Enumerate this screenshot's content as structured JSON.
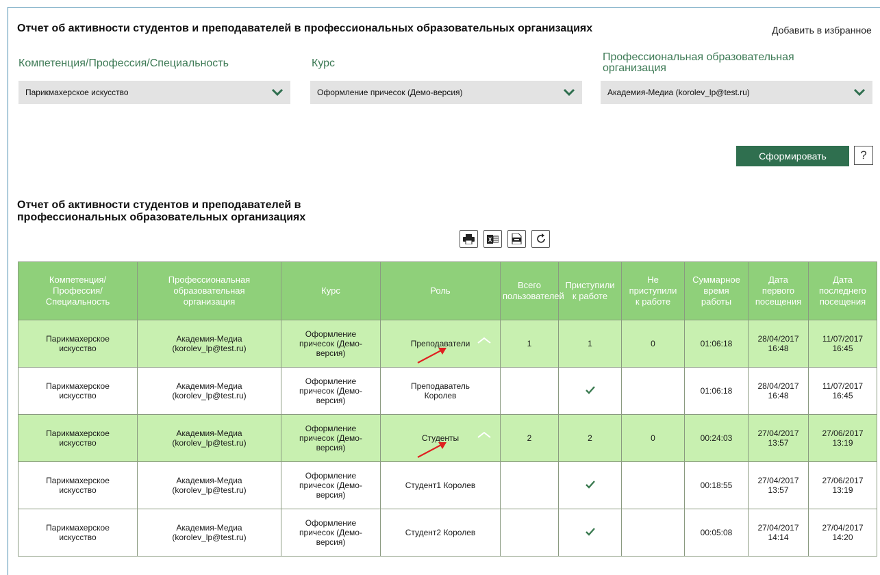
{
  "header": {
    "title": "Отчет об активности студентов и преподавателей в профессиональных образовательных организациях",
    "favorite": "Добавить в избранное"
  },
  "filters": {
    "competence": {
      "label": "Компетенция/Профессия/Специальность",
      "value": "Парикмахерское искусство"
    },
    "course": {
      "label": "Курс",
      "value": "Оформление причесок (Демо-версия)"
    },
    "organization": {
      "label_line1": "Профессиональная образовательная",
      "label_line2": "организация",
      "value": "Академия-Медиа (korolev_lp@test.ru)"
    }
  },
  "actions": {
    "generate": "Сформировать",
    "help": "?"
  },
  "report": {
    "title_line1": "Отчет об активности студентов и преподавателей в",
    "title_line2": "профессиональных образовательных организациях",
    "toolbar": [
      "print-icon",
      "excel-icon",
      "pdf-icon",
      "refresh-icon"
    ],
    "columns": [
      [
        "Компетенция/",
        "Профессия/",
        "Специальность"
      ],
      [
        "Профессиональная",
        "образовательная",
        "организация"
      ],
      [
        "Курс"
      ],
      [
        "Роль"
      ],
      [
        "Всего",
        "пользователей"
      ],
      [
        "Приступили",
        "к работе"
      ],
      [
        "Не",
        "приступили",
        "к работе"
      ],
      [
        "Суммарное",
        "время",
        "работы"
      ],
      [
        "Дата",
        "первого",
        "посещения"
      ],
      [
        "Дата",
        "последнего",
        "посещения"
      ]
    ],
    "rows": [
      {
        "type": "group",
        "competence": [
          "Парикмахерское",
          "искусство"
        ],
        "org": [
          "Академия-Медиа",
          "(korolev_lp@test.ru)"
        ],
        "course": [
          "Оформление",
          "причесок (Демо-",
          "версия)"
        ],
        "role": [
          "Преподаватели"
        ],
        "total": "1",
        "started": "1",
        "not_started": "0",
        "time": "01:06:18",
        "first": [
          "28/04/2017",
          "16:48"
        ],
        "last": [
          "11/07/2017",
          "16:45"
        ]
      },
      {
        "type": "detail",
        "competence": [
          "Парикмахерское",
          "искусство"
        ],
        "org": [
          "Академия-Медиа",
          "(korolev_lp@test.ru)"
        ],
        "course": [
          "Оформление",
          "причесок (Демо-",
          "версия)"
        ],
        "role": [
          "Преподаватель",
          "Королев"
        ],
        "total": "",
        "started": "check",
        "not_started": "",
        "time": "01:06:18",
        "first": [
          "28/04/2017",
          "16:48"
        ],
        "last": [
          "11/07/2017",
          "16:45"
        ]
      },
      {
        "type": "group",
        "competence": [
          "Парикмахерское",
          "искусство"
        ],
        "org": [
          "Академия-Медиа",
          "(korolev_lp@test.ru)"
        ],
        "course": [
          "Оформление",
          "причесок (Демо-",
          "версия)"
        ],
        "role": [
          "Студенты"
        ],
        "total": "2",
        "started": "2",
        "not_started": "0",
        "time": "00:24:03",
        "first": [
          "27/04/2017",
          "13:57"
        ],
        "last": [
          "27/06/2017",
          "13:19"
        ]
      },
      {
        "type": "detail",
        "competence": [
          "Парикмахерское",
          "искусство"
        ],
        "org": [
          "Академия-Медиа",
          "(korolev_lp@test.ru)"
        ],
        "course": [
          "Оформление",
          "причесок (Демо-",
          "версия)"
        ],
        "role": [
          "Студент1 Королев"
        ],
        "total": "",
        "started": "check",
        "not_started": "",
        "time": "00:18:55",
        "first": [
          "27/04/2017",
          "13:57"
        ],
        "last": [
          "27/06/2017",
          "13:19"
        ]
      },
      {
        "type": "detail",
        "competence": [
          "Парикмахерское",
          "искусство"
        ],
        "org": [
          "Академия-Медиа",
          "(korolev_lp@test.ru)"
        ],
        "course": [
          "Оформление",
          "причесок (Демо-",
          "версия)"
        ],
        "role": [
          "Студент2 Королев"
        ],
        "total": "",
        "started": "check",
        "not_started": "",
        "time": "00:05:08",
        "first": [
          "27/04/2017",
          "14:14"
        ],
        "last": [
          "27/04/2017",
          "14:20"
        ]
      }
    ]
  },
  "colors": {
    "accent": "#2f6f4f",
    "header_bg": "#8fd07a",
    "group_row": "#c8f0b0",
    "label": "#3d7a55",
    "arrow": "#e02020",
    "check": "#3a7a50"
  }
}
